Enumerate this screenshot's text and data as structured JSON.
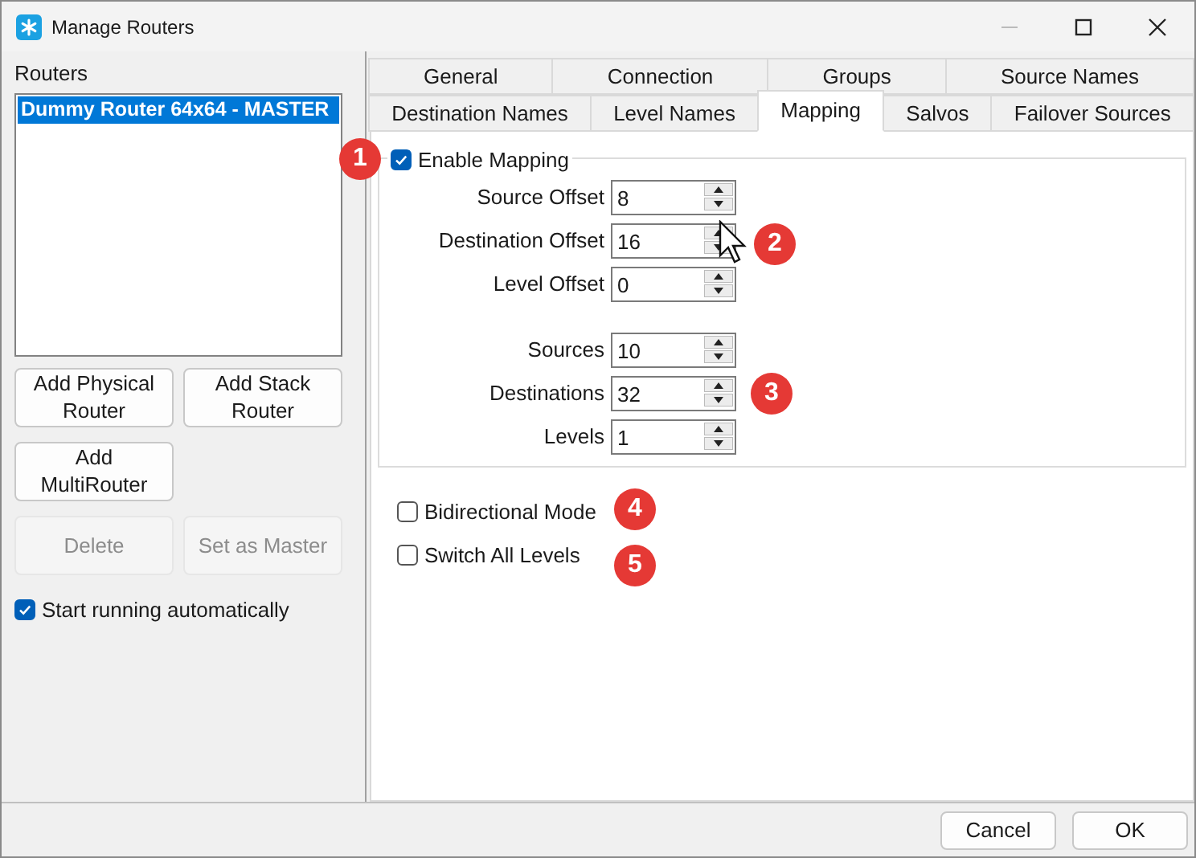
{
  "window": {
    "title": "Manage Routers"
  },
  "routers": {
    "label": "Routers",
    "items": [
      {
        "name": "Dummy Router 64x64 - MASTER",
        "selected": true
      }
    ]
  },
  "left_buttons": [
    {
      "label": "Add Physical Router",
      "disabled": false
    },
    {
      "label": "Add Stack Router",
      "disabled": false
    },
    {
      "label": "Add MultiRouter",
      "disabled": false
    },
    {
      "label": "Delete",
      "disabled": true
    },
    {
      "label": "Set as Master",
      "disabled": true
    }
  ],
  "start_running": {
    "label": "Start running automatically",
    "checked": true
  },
  "tab_rows": [
    [
      {
        "label": "General",
        "selected": false
      },
      {
        "label": "Connection",
        "selected": false
      },
      {
        "label": "Groups",
        "selected": false
      },
      {
        "label": "Source Names",
        "selected": false
      }
    ],
    [
      {
        "label": "Destination Names",
        "selected": false
      },
      {
        "label": "Level Names",
        "selected": false
      },
      {
        "label": "Mapping",
        "selected": true
      },
      {
        "label": "Salvos",
        "selected": false
      },
      {
        "label": "Failover Sources",
        "selected": false
      }
    ]
  ],
  "enable_mapping": {
    "label": "Enable Mapping",
    "checked": true
  },
  "offset_fields": [
    {
      "label": "Source Offset",
      "value": "8"
    },
    {
      "label": "Destination Offset",
      "value": "16"
    },
    {
      "label": "Level Offset",
      "value": "0"
    }
  ],
  "count_fields": [
    {
      "label": "Sources",
      "value": "10"
    },
    {
      "label": "Destinations",
      "value": "32"
    },
    {
      "label": "Levels",
      "value": "1"
    }
  ],
  "options": [
    {
      "label": "Bidirectional Mode",
      "checked": false
    },
    {
      "label": "Switch All Levels",
      "checked": false
    }
  ],
  "callouts": [
    "1",
    "2",
    "3",
    "4",
    "5"
  ],
  "footer_buttons": [
    "Cancel",
    "OK"
  ]
}
